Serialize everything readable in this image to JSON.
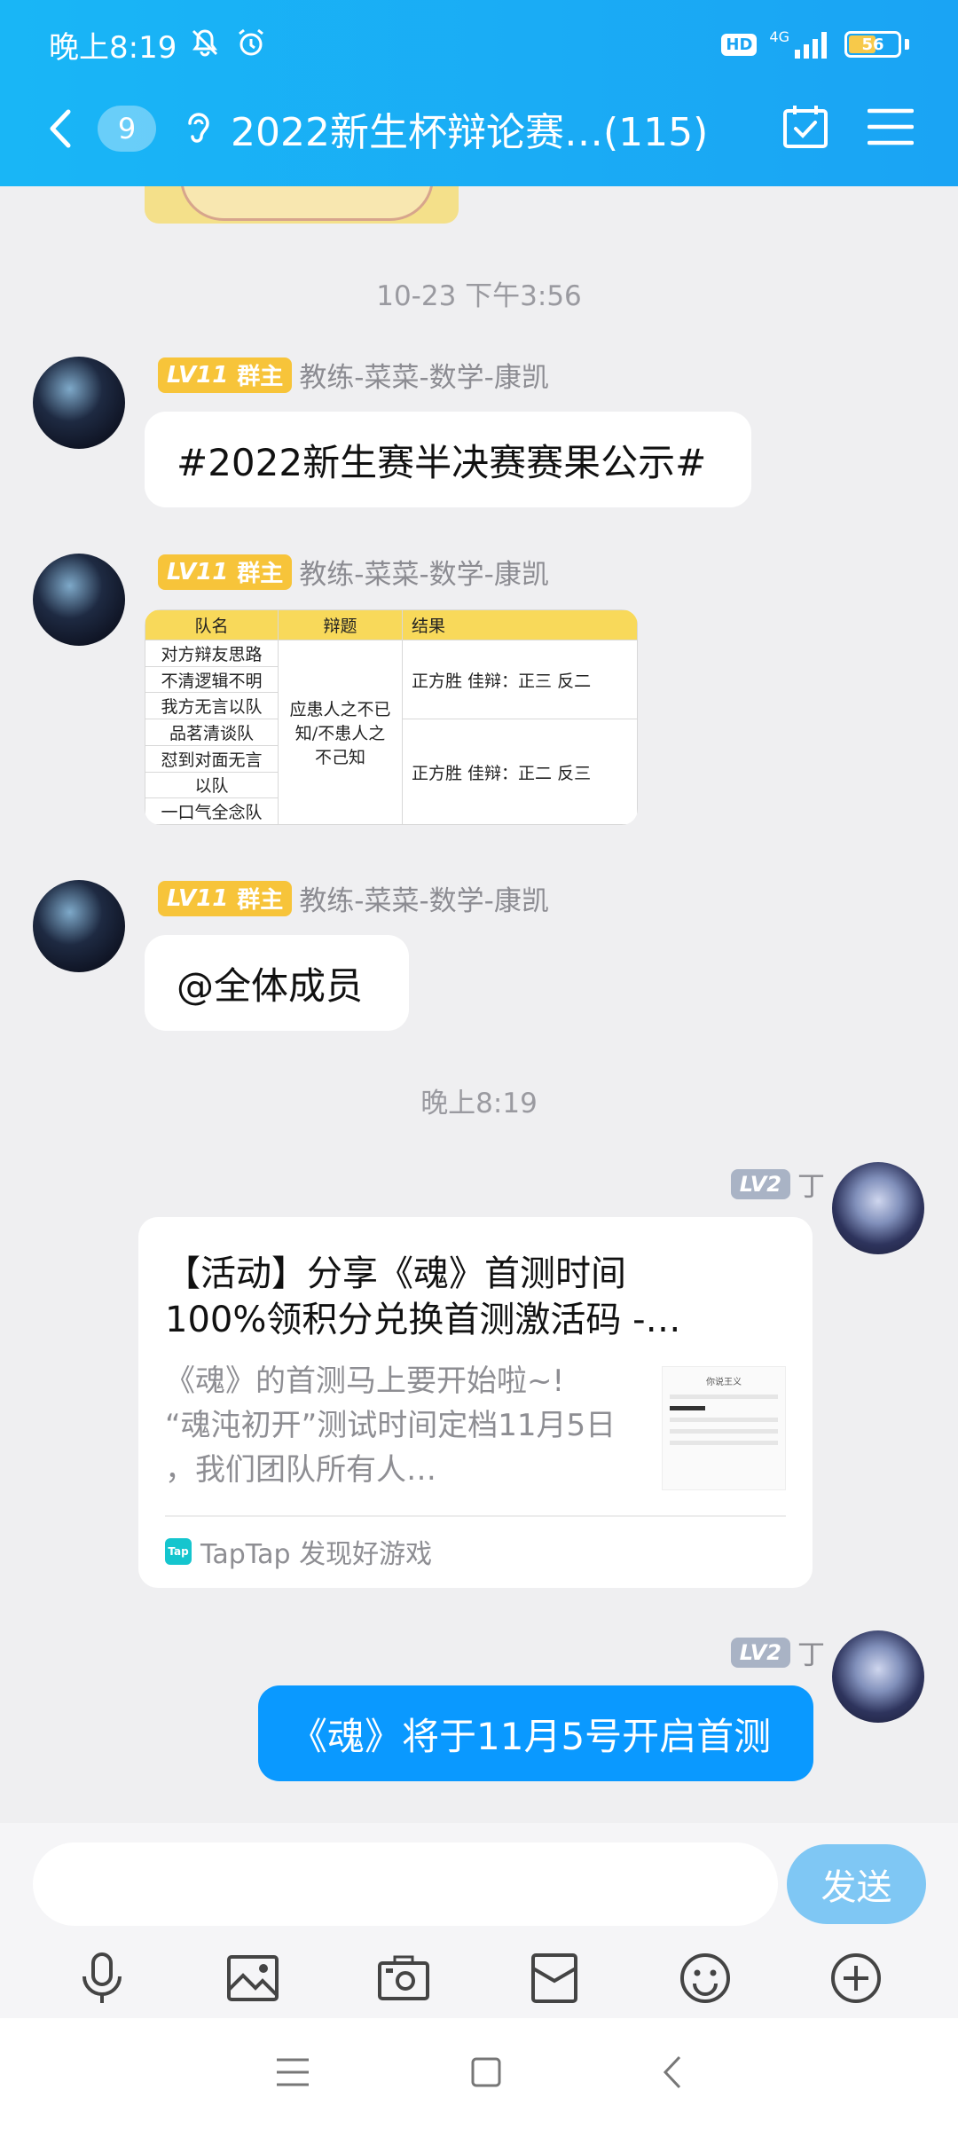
{
  "status_bar": {
    "time": "晚上8:19",
    "hd": "HD",
    "network": "4G",
    "battery": "56",
    "battery_level": 0.56
  },
  "header": {
    "unread_count": "9",
    "title": "2022新生杯辩论赛…(115)"
  },
  "chat": {
    "timestamps": [
      "10-23 下午3:56",
      "晚上8:19"
    ],
    "messages": [
      {
        "badge_level": "LV11",
        "badge_role": "群主",
        "sender": "教练-菜菜-数学-康凯",
        "text": "#2022新生赛半决赛赛果公示#"
      },
      {
        "badge_level": "LV11",
        "badge_role": "群主",
        "sender": "教练-菜菜-数学-康凯",
        "image_table": {
          "headers": [
            "队名",
            "辩题",
            "结果"
          ],
          "rows": [
            "对方辩友思路",
            "不清逻辑不明",
            "我方无言以队",
            "品茗清谈队",
            "怼到对面无言",
            "以队",
            "一口气全念队"
          ],
          "topic_lines": [
            "应患人之不已",
            "知/不患人之",
            "不己知"
          ],
          "result1": "正方胜 佳辩：正三 反二",
          "result2": "正方胜 佳辩：正二 反三"
        }
      },
      {
        "badge_level": "LV11",
        "badge_role": "群主",
        "sender": "教练-菜菜-数学-康凯",
        "text": "@全体成员"
      },
      {
        "badge_level": "LV2",
        "sender": "丁",
        "card": {
          "title_line1": "【活动】分享《魂》首测时间",
          "title_line2": "100%领积分兑换首测激活码 -…",
          "desc_line1": "《魂》的首测马上要开始啦~!",
          "desc_line2": "“魂沌初开”测试时间定档11月5日",
          "desc_line3": "，我们团队所有人…",
          "source": "TapTap 发现好游戏",
          "thumb_title": "你说王义"
        }
      },
      {
        "badge_level": "LV2",
        "sender": "丁",
        "text": "《魂》将于11月5号开启首测"
      }
    ]
  },
  "input": {
    "placeholder": "",
    "send_label": "发送"
  },
  "toolbar": [
    "mic-icon",
    "image-icon",
    "camera-icon",
    "red-packet-icon",
    "emoji-icon",
    "plus-icon"
  ],
  "colors": {
    "header": "#1aa4f4",
    "owner_badge": "#f7c43a",
    "my_bubble": "#0a99ff",
    "send_button": "#7fc7f4"
  }
}
